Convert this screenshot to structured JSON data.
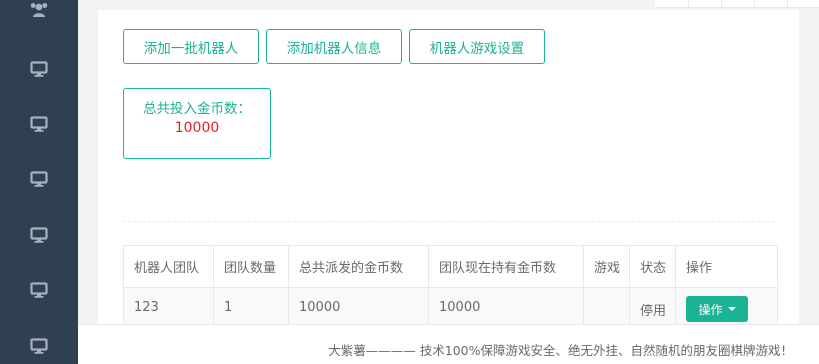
{
  "sidebar": {
    "items": [
      {
        "icon": "users-icon"
      },
      {
        "icon": "desktop-icon"
      },
      {
        "icon": "desktop-icon"
      },
      {
        "icon": "desktop-icon"
      },
      {
        "icon": "desktop-icon"
      },
      {
        "icon": "desktop-icon"
      },
      {
        "icon": "desktop-icon"
      }
    ]
  },
  "toolbar": {
    "add_batch_label": "添加一批机器人",
    "add_info_label": "添加机器人信息",
    "game_settings_label": "机器人游戏设置"
  },
  "summary": {
    "label": "总共投入金币数：",
    "value": "10000"
  },
  "table": {
    "headers": [
      "机器人团队",
      "团队数量",
      "总共派发的金币数",
      "团队现在持有金币数",
      "游戏",
      "状态",
      "操作"
    ],
    "rows": [
      {
        "team": "123",
        "count": "1",
        "total_distributed": "10000",
        "current_holding": "10000",
        "game": "",
        "status": "停用",
        "action_label": "操作"
      }
    ]
  },
  "footer": {
    "text": "大紫薯———— 技术100%保障游戏安全、绝无外挂、自然随机的朋友圈棋牌游戏！"
  },
  "colors": {
    "sidebar_bg": "#2f4050",
    "accent": "#1ab394",
    "value_red": "#ed1c24"
  }
}
